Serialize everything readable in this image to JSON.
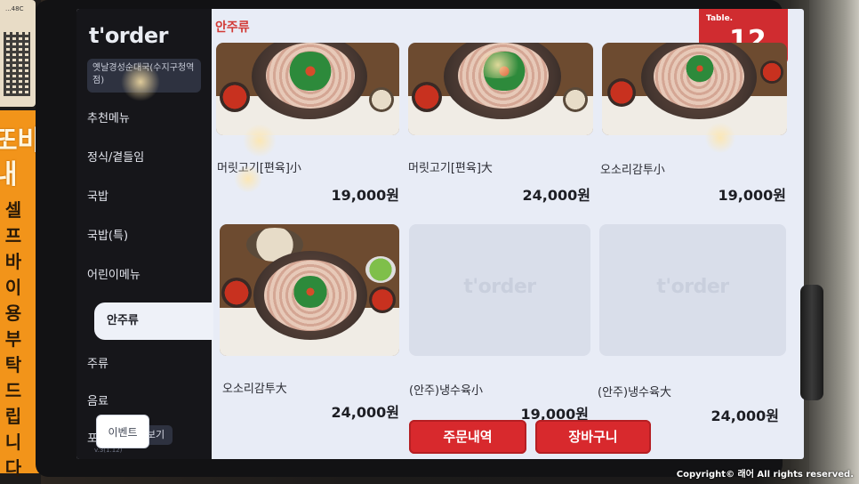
{
  "background_sign": {
    "qr_code": "...48C",
    "big_text": [
      "또바",
      "내"
    ],
    "vertical_text": [
      "셀",
      "프",
      "바",
      "이",
      "용",
      "부",
      "탁",
      "드",
      "립",
      "니",
      "다",
      "!"
    ]
  },
  "sidebar": {
    "logo": "t'order",
    "store_name": "옛날경성순대국(수지구청역점)",
    "items": [
      {
        "label": "추천메뉴"
      },
      {
        "label": "정식/곁들임"
      },
      {
        "label": "국밥"
      },
      {
        "label": "국밥(특)"
      },
      {
        "label": "어린이메뉴"
      },
      {
        "label": "안주류"
      },
      {
        "label": "주류"
      },
      {
        "label": "음료"
      },
      {
        "label": "포장"
      }
    ],
    "more_label": "더보기",
    "version": "v.3(1.12)"
  },
  "header": {
    "category_title": "안주류",
    "table_label": "Table.",
    "table_number": "12"
  },
  "menu_items": [
    {
      "name": "머릿고기[편육]小",
      "price": "19,000원"
    },
    {
      "name": "머릿고기[편육]大",
      "price": "24,000원"
    },
    {
      "name": "오소리감투小",
      "price": "19,000원"
    },
    {
      "name": "오소리감투大",
      "price": "24,000원"
    },
    {
      "name": "(안주)냉수육小",
      "price": "19,000원"
    },
    {
      "name": "(안주)냉수육大",
      "price": "24,000원"
    }
  ],
  "placeholder_logo": "t'order",
  "footer": {
    "event_label": "이벤트",
    "order_history_label": "주문내역",
    "cart_label": "장바구니"
  },
  "watermark": "Copyright© 래어 All rights reserved.",
  "colors": {
    "accent_red": "#d8292d",
    "sidebar_bg": "#16161a",
    "screen_bg": "#e8ecf6",
    "sign_orange": "#f2941a"
  }
}
